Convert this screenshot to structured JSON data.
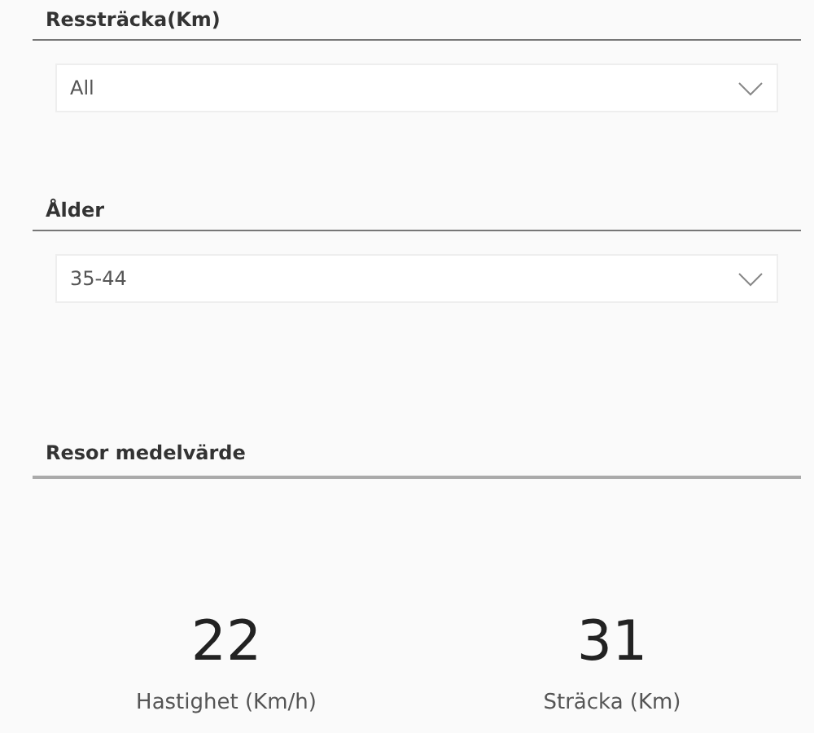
{
  "slicers": [
    {
      "title": "Ressträcka(Km)",
      "value": "All"
    },
    {
      "title": "Ålder",
      "value": "35-44"
    }
  ],
  "summary": {
    "title": "Resor medelvärde",
    "cards": [
      {
        "value": "22",
        "label": "Hastighet (Km/h)"
      },
      {
        "value": "31",
        "label": "Sträcka (Km)"
      }
    ]
  }
}
